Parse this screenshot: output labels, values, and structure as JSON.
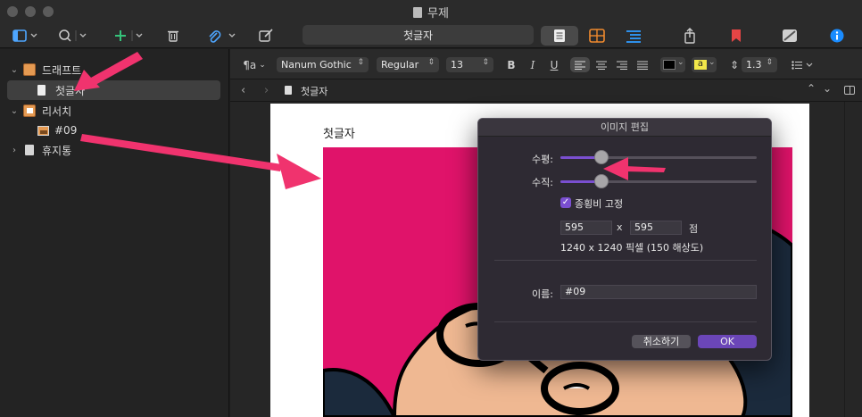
{
  "window": {
    "title": "무제"
  },
  "toolbar": {
    "center_title": "첫글자"
  },
  "sidebar": {
    "items": [
      {
        "label": "드래프트",
        "icon": "binder-icon",
        "expanded": true
      },
      {
        "label": "첫글자",
        "icon": "document-icon",
        "selected": true
      },
      {
        "label": "리서치",
        "icon": "research-folder-icon",
        "expanded": true
      },
      {
        "label": "#09",
        "icon": "image-icon"
      },
      {
        "label": "휴지통",
        "icon": "trash-icon",
        "expanded": false
      }
    ]
  },
  "format": {
    "paragraph_style": "¶a",
    "font_family": "Nanum Gothic",
    "font_weight": "Regular",
    "font_size": "13",
    "bold": "B",
    "italic": "I",
    "underline": "U",
    "highlight": "a",
    "line_spacing": "1.3"
  },
  "navbar": {
    "doc_title": "첫글자"
  },
  "document": {
    "heading": "첫글자"
  },
  "dialog": {
    "title": "이미지 편집",
    "horizontal_label": "수평:",
    "vertical_label": "수직:",
    "horizontal_value": 0.21,
    "vertical_value": 0.21,
    "lock_ratio_label": "종횡비 고정",
    "lock_ratio_checked": true,
    "width_value": "595",
    "x_label": "x",
    "height_value": "595",
    "unit_label": "점",
    "pixel_info": "1240 x 1240 픽셀 (150 해상도)",
    "name_label": "이름:",
    "name_value": "#09",
    "cancel_label": "취소하기",
    "ok_label": "OK"
  },
  "colors": {
    "accent": "#7a4fd0",
    "arrow": "#f0336e",
    "image_bg": "#e0136a",
    "highlight_yellow": "#f3e84a"
  }
}
